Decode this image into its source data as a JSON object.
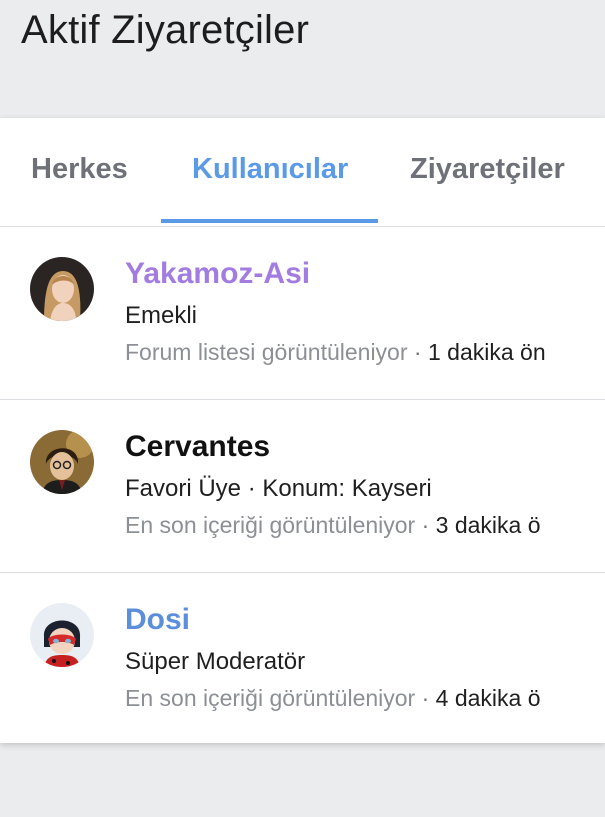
{
  "page": {
    "title": "Aktif Ziyaretçiler"
  },
  "tabs": [
    {
      "label": "Herkes",
      "active": false
    },
    {
      "label": "Kullanıcılar",
      "active": true
    },
    {
      "label": "Ziyaretçiler",
      "active": false
    }
  ],
  "colors": {
    "accent": "#5b9ae6",
    "name_purple": "#a27ce0",
    "name_black": "#111111",
    "name_blue": "#5b8fdc"
  },
  "members": [
    {
      "name": "Yakamoz-Asi",
      "name_color": "#a27ce0",
      "title": "Emekli",
      "activity": "Forum listesi görüntüleniyor",
      "separator": "·",
      "time": "1 dakika ön"
    },
    {
      "name": "Cervantes",
      "name_color": "#111111",
      "title": "Favori Üye · Konum: Kayseri",
      "activity": "En son içeriği görüntüleniyor",
      "separator": "·",
      "time": "3 dakika ö"
    },
    {
      "name": "Dosi",
      "name_color": "#5b8fdc",
      "title": "Süper Moderatör",
      "activity": "En son içeriği görüntüleniyor",
      "separator": "·",
      "time": "4 dakika ö"
    }
  ]
}
